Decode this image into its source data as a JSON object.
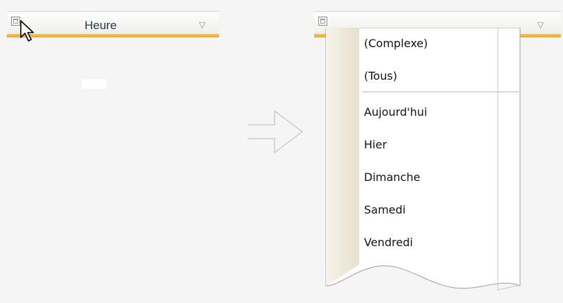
{
  "header_left": {
    "title": "Heure",
    "dropdown_icon": "triangle-down-icon",
    "filter_icon": "filter-icon"
  },
  "header_right": {
    "dropdown_icon": "triangle-down-icon",
    "filter_icon": "filter-icon"
  },
  "arrow_icon": "right-arrow-icon",
  "cursor_icon": "mouse-pointer-icon",
  "colors": {
    "accent": "#e8a92a",
    "header_text": "#223b50"
  },
  "menu": {
    "items_top": [
      "(Complexe)",
      "(Tous)"
    ],
    "items_bottom": [
      "Aujourd'hui",
      "Hier",
      "Dimanche",
      "Samedi",
      "Vendredi"
    ]
  }
}
